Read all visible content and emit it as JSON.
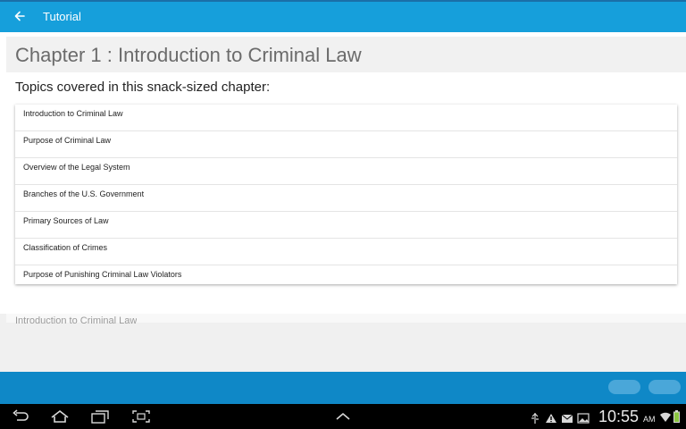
{
  "app": {
    "title": "Tutorial"
  },
  "chapter": {
    "title": "Chapter 1 : Introduction to Criminal Law",
    "topics_heading": "Topics covered in this snack-sized chapter:",
    "topics": [
      "Introduction to Criminal Law",
      "Purpose of Criminal Law",
      "Overview of the Legal System",
      "Branches of the U.S. Government",
      "Primary Sources of Law",
      "Classification of Crimes",
      "Purpose of Punishing Criminal Law Violators"
    ]
  },
  "next_section": {
    "title": "Introduction to Criminal Law"
  },
  "system_bar": {
    "time": "10:55",
    "ampm": "AM"
  },
  "colors": {
    "app_bar": "#169fdb",
    "footer": "#0f88c7",
    "nav_bar": "#000000"
  },
  "icons": [
    "back-arrow-icon",
    "nav-back-icon",
    "home-icon",
    "recent-apps-icon",
    "screenshot-icon",
    "up-chevron-icon",
    "usb-icon",
    "warning-icon",
    "mail-icon",
    "image-icon",
    "wifi-icon",
    "battery-icon"
  ]
}
